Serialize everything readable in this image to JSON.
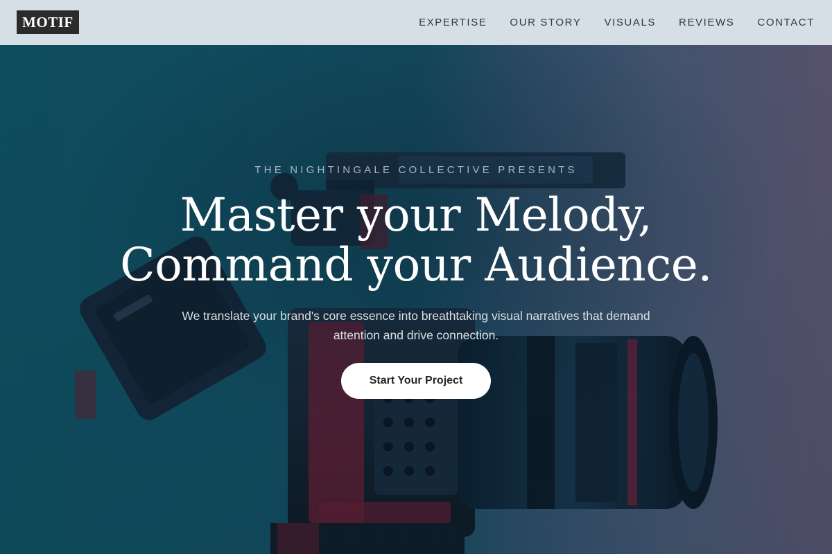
{
  "brand": {
    "logo_text": "MOTIF"
  },
  "nav": {
    "items": [
      {
        "label": "EXPERTISE"
      },
      {
        "label": "OUR STORY"
      },
      {
        "label": "VISUALS"
      },
      {
        "label": "REVIEWS"
      },
      {
        "label": "CONTACT"
      }
    ]
  },
  "hero": {
    "eyebrow": "THE NIGHTINGALE COLLECTIVE PRESENTS",
    "headline_line1": "Master your Melody,",
    "headline_line2": "Command your Audience.",
    "subtext": "We translate your brand's core essence into breathtaking visual narratives that demand attention and drive connection.",
    "cta_label": "Start Your Project",
    "background_image": "camera-rig-photo"
  },
  "colors": {
    "header_bg": "#d6dfe5",
    "logo_bg": "#2b2b2b",
    "hero_teal": "#0d4f60",
    "hero_mauve": "#5a546f",
    "cta_bg": "#ffffff"
  }
}
